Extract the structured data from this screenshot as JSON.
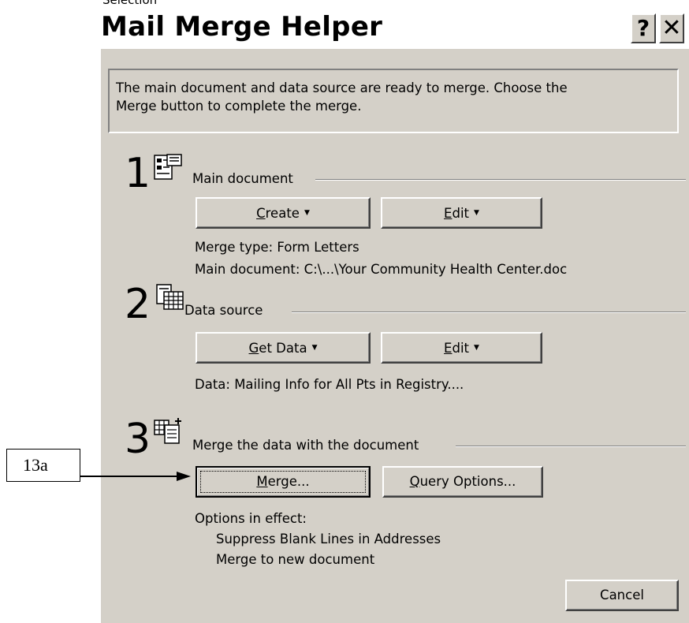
{
  "clipped_text": "Selection",
  "dialog": {
    "title": "Mail Merge Helper",
    "help_glyph": "?",
    "close_glyph": "✕",
    "info_line1": "The main document and data source are ready to merge. Choose the",
    "info_line2": "Merge button to complete the merge."
  },
  "step1": {
    "number": "1",
    "label": "Main document",
    "create_pre": "",
    "create_mnemonic": "C",
    "create_post": "reate",
    "edit_mnemonic": "E",
    "edit_post": "dit",
    "merge_type": "Merge type: Form Letters",
    "main_doc": "Main document: C:\\...\\Your Community Health Center.doc"
  },
  "step2": {
    "number": "2",
    "label": "Data source",
    "getdata_mnemonic": "G",
    "getdata_post": "et Data",
    "edit_mnemonic": "E",
    "edit_post": "dit",
    "data": "Data: Mailing Info for All Pts in Registry...."
  },
  "step3": {
    "number": "3",
    "label": "Merge the data with the document",
    "merge_mnemonic": "M",
    "merge_post": "erge...",
    "query_mnemonic": "Q",
    "query_post": "uery Options...",
    "options_title": "Options in effect:",
    "option1": "Suppress Blank Lines in Addresses",
    "option2": "Merge to new document"
  },
  "cancel_label": "Cancel",
  "annotation": {
    "label": "13a"
  },
  "icons": [
    "document-icon",
    "data-table-icon",
    "merge-icon",
    "dropdown-arrow-icon"
  ]
}
